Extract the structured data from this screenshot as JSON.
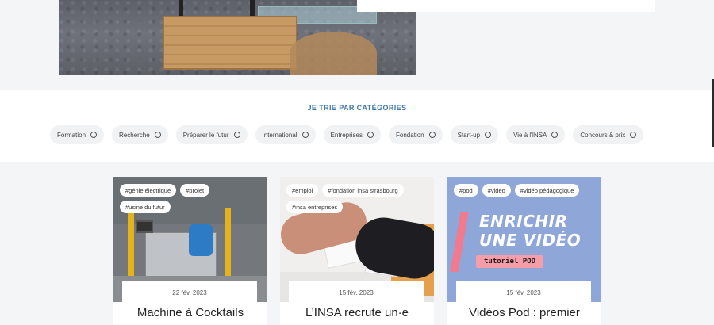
{
  "categories": {
    "title": "JE TRIE PAR CATÉGORIES",
    "items": [
      {
        "label": "Formation"
      },
      {
        "label": "Recherche"
      },
      {
        "label": "Préparer le futur"
      },
      {
        "label": "International"
      },
      {
        "label": "Entreprises"
      },
      {
        "label": "Fondation"
      },
      {
        "label": "Start-up"
      },
      {
        "label": "Vie à l'INSA"
      },
      {
        "label": "Concours & prix"
      }
    ]
  },
  "cards": [
    {
      "tags": [
        "#génie électrique",
        "#projet",
        "#usine du futur"
      ],
      "date": "22 fév. 2023",
      "title": "Machine à Cocktails"
    },
    {
      "tags": [
        "#emploi",
        "#fondation insa strasbourg",
        "#insa entreprises"
      ],
      "date": "15 fév. 2023",
      "title": "L’INSA recrute un·e"
    },
    {
      "tags": [
        "#pod",
        "#vidéo",
        "#vidéo pédagogique"
      ],
      "date": "15 fév. 2023",
      "title": "Vidéos Pod : premier",
      "image_text": {
        "headline_1": "ENRICHIR",
        "headline_2": "UNE VIDÉO",
        "subtitle": "tutoriel POD"
      }
    }
  ]
}
